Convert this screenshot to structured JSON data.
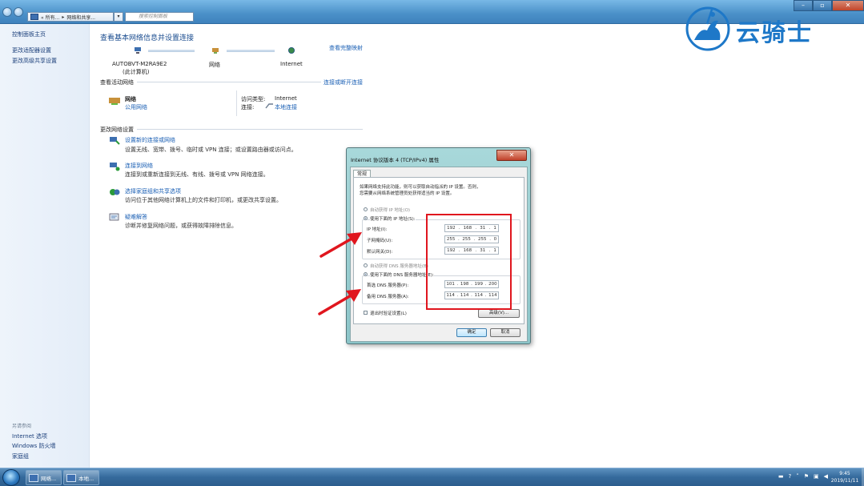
{
  "titlebar": {
    "breadcrumb_1": "« 所有...",
    "breadcrumb_sep": "▸",
    "breadcrumb_2": "网络和共享...",
    "search_placeholder": "搜索控制面板",
    "minimize": "–",
    "maximize": "▫",
    "close": "✕"
  },
  "sidebar": {
    "items": [
      {
        "label": "控制面板主页"
      },
      {
        "label": "更改适配器设置"
      },
      {
        "label": "更改高级共享设置"
      }
    ],
    "see_also_label": "另请参阅",
    "see_also": [
      {
        "label": "Internet 选项"
      },
      {
        "label": "Windows 防火墙"
      },
      {
        "label": "家庭组"
      }
    ]
  },
  "main": {
    "title": "查看基本网络信息并设置连接",
    "view_full_map": "查看完整映射",
    "network_map": [
      {
        "label": "AUTOBVT-M2RA9E2",
        "sub": "(此计算机)"
      },
      {
        "label": "网络",
        "sub": ""
      },
      {
        "label": "Internet",
        "sub": ""
      }
    ],
    "active_networks_label": "查看活动网络",
    "connect_disconnect": "连接或断开连接",
    "active_network": {
      "name": "网络",
      "type": "公用网络",
      "access_type_label": "访问类型:",
      "access_type_value": "Internet",
      "connection_label": "连接:",
      "connection_value": "本地连接"
    },
    "change_settings_label": "更改网络设置",
    "tasks": [
      {
        "title": "设置新的连接或网络",
        "desc": "设置无线、宽带、拨号、临时或 VPN 连接；或设置路由器或访问点。"
      },
      {
        "title": "连接到网络",
        "desc": "连接到或重新连接到无线、有线、拨号或 VPN 网络连接。"
      },
      {
        "title": "选择家庭组和共享选项",
        "desc": "访问位于其他网络计算机上的文件和打印机，或更改共享设置。"
      },
      {
        "title": "疑难解答",
        "desc": "诊断并修复网络问题，或获得故障排除信息。"
      }
    ]
  },
  "dialog": {
    "title": "Internet 协议版本 4 (TCP/IPv4) 属性",
    "close": "✕",
    "tab": "常规",
    "desc_line1": "如果网络支持此功能，则可以获取自动指派的 IP 设置。否则，",
    "desc_line2": "您需要从网络系统管理员处获得适当的 IP 设置。",
    "auto_ip": "自动获得 IP 地址(O)",
    "manual_ip": "使用下面的 IP 地址(S):",
    "ip_label": "IP 地址(I):",
    "ip_value": [
      "192",
      "168",
      "31",
      "1"
    ],
    "mask_label": "子网掩码(U):",
    "mask_value": [
      "255",
      "255",
      "255",
      "0"
    ],
    "gateway_label": "默认网关(D):",
    "gateway_value": [
      "192",
      "168",
      "31",
      "1"
    ],
    "auto_dns": "自动获得 DNS 服务器地址(B)",
    "manual_dns": "使用下面的 DNS 服务器地址(E):",
    "dns1_label": "首选 DNS 服务器(P):",
    "dns1_value": [
      "101",
      "198",
      "199",
      "200"
    ],
    "dns2_label": "备用 DNS 服务器(A):",
    "dns2_value": [
      "114",
      "114",
      "114",
      "114"
    ],
    "validate": "退出时验证设置(L)",
    "advanced": "高级(V)...",
    "ok": "确定",
    "cancel": "取消"
  },
  "watermark": {
    "text": "云骑士"
  },
  "taskbar": {
    "items": [
      {
        "label": "网络..."
      },
      {
        "label": "本地..."
      }
    ],
    "time": "9:45",
    "date": "2019/11/11"
  },
  "colors": {
    "accent": "#1a5fb4",
    "annotation_red": "#e0161e",
    "watermark_blue": "#1e78c8"
  }
}
